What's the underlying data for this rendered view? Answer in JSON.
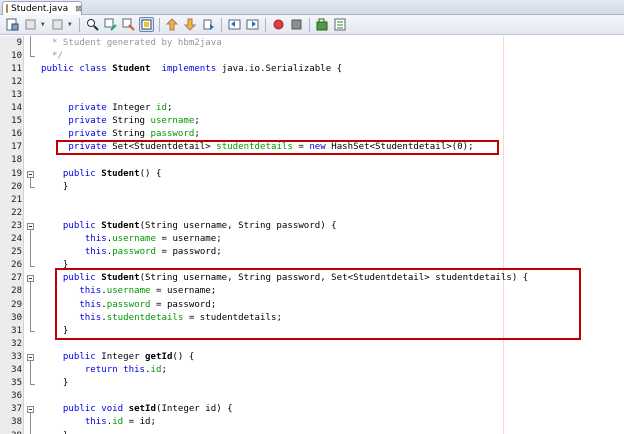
{
  "tab": {
    "title": "Student.java",
    "close": "⊠"
  },
  "toolbar": {
    "icons": [
      "last-edit-icon",
      "back-icon",
      "forward-icon",
      "find-selection-icon",
      "find-previous-icon",
      "find-next-icon",
      "toggle-highlight-icon",
      "previous-bookmark-icon",
      "next-bookmark-icon",
      "toggle-bookmark-icon",
      "shift-left-icon",
      "shift-right-icon",
      "start-macro-icon",
      "stop-macro-icon",
      "check-icon",
      "comment-icon"
    ]
  },
  "lines": [
    {
      "n": "9",
      "t": [
        [
          "cm",
          "  * Student generated by hbm2java"
        ]
      ]
    },
    {
      "n": "10",
      "t": [
        [
          "cm",
          "  */"
        ]
      ]
    },
    {
      "n": "11",
      "t": [
        [
          "kw",
          "public class "
        ],
        [
          "bd",
          "Student"
        ],
        [
          "kw",
          "  implements "
        ],
        [
          "",
          "java.io.Serializable {"
        ]
      ]
    },
    {
      "n": "12",
      "t": []
    },
    {
      "n": "13",
      "t": []
    },
    {
      "n": "14",
      "t": [
        [
          "",
          "     "
        ],
        [
          "kw",
          "private "
        ],
        [
          "",
          "Integer "
        ],
        [
          "fd",
          "id"
        ],
        [
          "",
          ";"
        ]
      ]
    },
    {
      "n": "15",
      "t": [
        [
          "",
          "     "
        ],
        [
          "kw",
          "private "
        ],
        [
          "",
          "String "
        ],
        [
          "fd",
          "username"
        ],
        [
          "",
          ";"
        ]
      ]
    },
    {
      "n": "16",
      "t": [
        [
          "",
          "     "
        ],
        [
          "kw",
          "private "
        ],
        [
          "",
          "String "
        ],
        [
          "fd",
          "password"
        ],
        [
          "",
          ";"
        ]
      ]
    },
    {
      "n": "17",
      "t": [
        [
          "",
          "     "
        ],
        [
          "kw",
          "private "
        ],
        [
          "",
          "Set<Studentdetail> "
        ],
        [
          "fd",
          "studentdetails"
        ],
        [
          "",
          " = "
        ],
        [
          "kw",
          "new "
        ],
        [
          "",
          "HashSet<Studentdetail>(0);"
        ]
      ]
    },
    {
      "n": "18",
      "t": []
    },
    {
      "n": "19",
      "t": [
        [
          "",
          "    "
        ],
        [
          "kw",
          "public "
        ],
        [
          "bd",
          "Student"
        ],
        [
          "",
          "() {"
        ]
      ]
    },
    {
      "n": "20",
      "t": [
        [
          "",
          "    }"
        ]
      ]
    },
    {
      "n": "21",
      "t": []
    },
    {
      "n": "22",
      "t": []
    },
    {
      "n": "23",
      "t": [
        [
          "",
          "    "
        ],
        [
          "kw",
          "public "
        ],
        [
          "bd",
          "Student"
        ],
        [
          "",
          "(String username, String password) {"
        ]
      ]
    },
    {
      "n": "24",
      "t": [
        [
          "",
          "        "
        ],
        [
          "kw",
          "this"
        ],
        [
          "",
          "."
        ],
        [
          "fd",
          "username"
        ],
        [
          "",
          " = username;"
        ]
      ]
    },
    {
      "n": "25",
      "t": [
        [
          "",
          "        "
        ],
        [
          "kw",
          "this"
        ],
        [
          "",
          "."
        ],
        [
          "fd",
          "password"
        ],
        [
          "",
          " = password;"
        ]
      ]
    },
    {
      "n": "26",
      "t": [
        [
          "",
          "    }"
        ]
      ]
    },
    {
      "n": "27",
      "t": [
        [
          "",
          "    "
        ],
        [
          "kw",
          "public "
        ],
        [
          "bd",
          "Student"
        ],
        [
          "",
          "(String username, String password, Set<Studentdetail> studentdetails) {"
        ]
      ]
    },
    {
      "n": "28",
      "t": [
        [
          "",
          "       "
        ],
        [
          "kw",
          "this"
        ],
        [
          "",
          "."
        ],
        [
          "fd",
          "username"
        ],
        [
          "",
          " = username;"
        ]
      ]
    },
    {
      "n": "29",
      "t": [
        [
          "",
          "       "
        ],
        [
          "kw",
          "this"
        ],
        [
          "",
          "."
        ],
        [
          "fd",
          "password"
        ],
        [
          "",
          " = password;"
        ]
      ]
    },
    {
      "n": "30",
      "t": [
        [
          "",
          "       "
        ],
        [
          "kw",
          "this"
        ],
        [
          "",
          "."
        ],
        [
          "fd",
          "studentdetails"
        ],
        [
          "",
          " = studentdetails;"
        ]
      ]
    },
    {
      "n": "31",
      "t": [
        [
          "",
          "    }"
        ]
      ]
    },
    {
      "n": "32",
      "t": []
    },
    {
      "n": "33",
      "t": [
        [
          "",
          "    "
        ],
        [
          "kw",
          "public "
        ],
        [
          "",
          "Integer "
        ],
        [
          "bd",
          "getId"
        ],
        [
          "",
          "() {"
        ]
      ]
    },
    {
      "n": "34",
      "t": [
        [
          "",
          "        "
        ],
        [
          "kw",
          "return this"
        ],
        [
          "",
          "."
        ],
        [
          "fd",
          "id"
        ],
        [
          "",
          ";"
        ]
      ]
    },
    {
      "n": "35",
      "t": [
        [
          "",
          "    }"
        ]
      ]
    },
    {
      "n": "36",
      "t": []
    },
    {
      "n": "37",
      "t": [
        [
          "",
          "    "
        ],
        [
          "kw",
          "public void "
        ],
        [
          "bd",
          "setId"
        ],
        [
          "",
          "(Integer id) {"
        ]
      ]
    },
    {
      "n": "38",
      "t": [
        [
          "",
          "        "
        ],
        [
          "kw",
          "this"
        ],
        [
          "",
          "."
        ],
        [
          "fd",
          "id"
        ],
        [
          "",
          " = id;"
        ]
      ]
    },
    {
      "n": "39",
      "t": [
        [
          "",
          "    }"
        ]
      ]
    }
  ],
  "colors": {
    "keyword": "#0000e6",
    "field": "#009900",
    "comment": "#969696",
    "highlight_box": "#c00000"
  }
}
